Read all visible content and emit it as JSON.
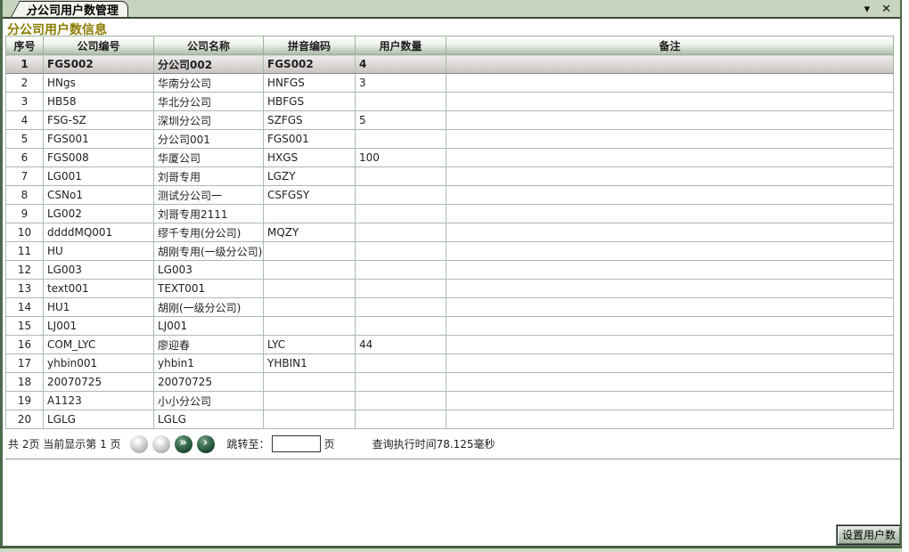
{
  "window": {
    "tab_title": "分公司用户数管理",
    "controls": {
      "collapse": "▾",
      "close": "✕"
    }
  },
  "page_title": "分公司用户数信息",
  "table": {
    "columns": [
      "序号",
      "公司编号",
      "公司名称",
      "拼音编码",
      "用户数量",
      "备注"
    ],
    "rows": [
      {
        "index": "1",
        "code": "FGS002",
        "name": "分公司002",
        "pinyin": "FGS002",
        "users": "4",
        "remark": "",
        "selected": true
      },
      {
        "index": "2",
        "code": "HNgs",
        "name": "华南分公司",
        "pinyin": "HNFGS",
        "users": "3",
        "remark": "",
        "selected": false
      },
      {
        "index": "3",
        "code": "HB58",
        "name": "华北分公司",
        "pinyin": "HBFGS",
        "users": "",
        "remark": "",
        "selected": false
      },
      {
        "index": "4",
        "code": "FSG-SZ",
        "name": "深圳分公司",
        "pinyin": "SZFGS",
        "users": "5",
        "remark": "",
        "selected": false
      },
      {
        "index": "5",
        "code": "FGS001",
        "name": "分公司001",
        "pinyin": "FGS001",
        "users": "",
        "remark": "",
        "selected": false
      },
      {
        "index": "6",
        "code": "FGS008",
        "name": "华厦公司",
        "pinyin": "HXGS",
        "users": "100",
        "remark": "",
        "selected": false
      },
      {
        "index": "7",
        "code": "LG001",
        "name": "刘哥专用",
        "pinyin": "LGZY",
        "users": "",
        "remark": "",
        "selected": false
      },
      {
        "index": "8",
        "code": "CSNo1",
        "name": "测试分公司一",
        "pinyin": "CSFGSY",
        "users": "",
        "remark": "",
        "selected": false
      },
      {
        "index": "9",
        "code": "LG002",
        "name": "刘哥专用2111",
        "pinyin": "",
        "users": "",
        "remark": "",
        "selected": false
      },
      {
        "index": "10",
        "code": "ddddMQ001",
        "name": "缪千专用(分公司)",
        "pinyin": "MQZY",
        "users": "",
        "remark": "",
        "selected": false
      },
      {
        "index": "11",
        "code": "HU",
        "name": "胡刚专用(一级分公司)",
        "pinyin": "",
        "users": "",
        "remark": "",
        "selected": false
      },
      {
        "index": "12",
        "code": "LG003",
        "name": "LG003",
        "pinyin": "",
        "users": "",
        "remark": "",
        "selected": false
      },
      {
        "index": "13",
        "code": "text001",
        "name": "TEXT001",
        "pinyin": "",
        "users": "",
        "remark": "",
        "selected": false
      },
      {
        "index": "14",
        "code": "HU1",
        "name": "胡刚(一级分公司)",
        "pinyin": "",
        "users": "",
        "remark": "",
        "selected": false
      },
      {
        "index": "15",
        "code": "LJ001",
        "name": "LJ001",
        "pinyin": "",
        "users": "",
        "remark": "",
        "selected": false
      },
      {
        "index": "16",
        "code": "COM_LYC",
        "name": "廖迎春",
        "pinyin": "LYC",
        "users": "44",
        "remark": "",
        "selected": false
      },
      {
        "index": "17",
        "code": "yhbin001",
        "name": "yhbin1",
        "pinyin": "YHBIN1",
        "users": "",
        "remark": "",
        "selected": false
      },
      {
        "index": "18",
        "code": "20070725",
        "name": "20070725",
        "pinyin": "",
        "users": "",
        "remark": "",
        "selected": false
      },
      {
        "index": "19",
        "code": "A1123",
        "name": "小小分公司",
        "pinyin": "",
        "users": "",
        "remark": "",
        "selected": false
      },
      {
        "index": "20",
        "code": "LGLG",
        "name": "LGLG",
        "pinyin": "",
        "users": "",
        "remark": "",
        "selected": false
      }
    ]
  },
  "pagination": {
    "summary": "共 2页 当前显示第 1 页",
    "buttons": [
      {
        "name": "prev-page",
        "glyph": "‹",
        "enabled": false
      },
      {
        "name": "first-page",
        "glyph": "«",
        "enabled": false
      },
      {
        "name": "last-page",
        "glyph": "»",
        "enabled": true
      },
      {
        "name": "next-page",
        "glyph": "›",
        "enabled": true
      }
    ],
    "jump_label": "跳转至：",
    "jump_value": "",
    "jump_suffix": "页",
    "exec_time": "查询执行时间78.125毫秒"
  },
  "footer": {
    "set_users_button": "设置用户数"
  },
  "colors": {
    "tabbar_bg": "#c9d4bf",
    "title_text": "#8a7c00",
    "grid_line": "#a9bba9",
    "frame_green": "#4d6a4b",
    "active_circle": "#1b4832",
    "disabled_circle": "#b8b8b8"
  }
}
